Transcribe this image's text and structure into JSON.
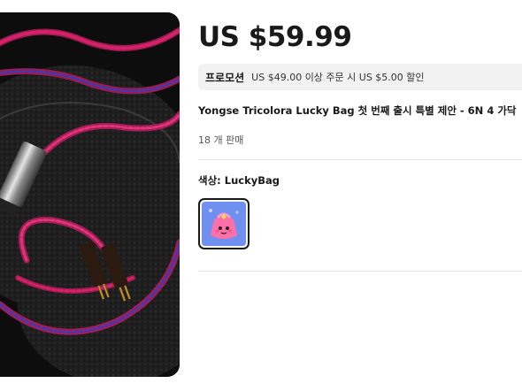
{
  "product": {
    "price": "US $59.99",
    "promo": {
      "label": "프로모션",
      "text": "US $49.00 이상 주문 시 US $5.00 할인"
    },
    "title": "Yongse Tricolora Lucky Bag 첫 번째 출시 특별 제안 - 6N 4 가닥",
    "sold": "18 개 판매",
    "color": {
      "label": "색상: LuckyBag",
      "selected": "LuckyBag"
    }
  },
  "colors": {
    "text": "#191919",
    "promo_bg": "#f2f2f2",
    "divider": "#e6e6e6",
    "cable_pink": "#d4216a",
    "cable_blue": "#3b3bb8"
  }
}
